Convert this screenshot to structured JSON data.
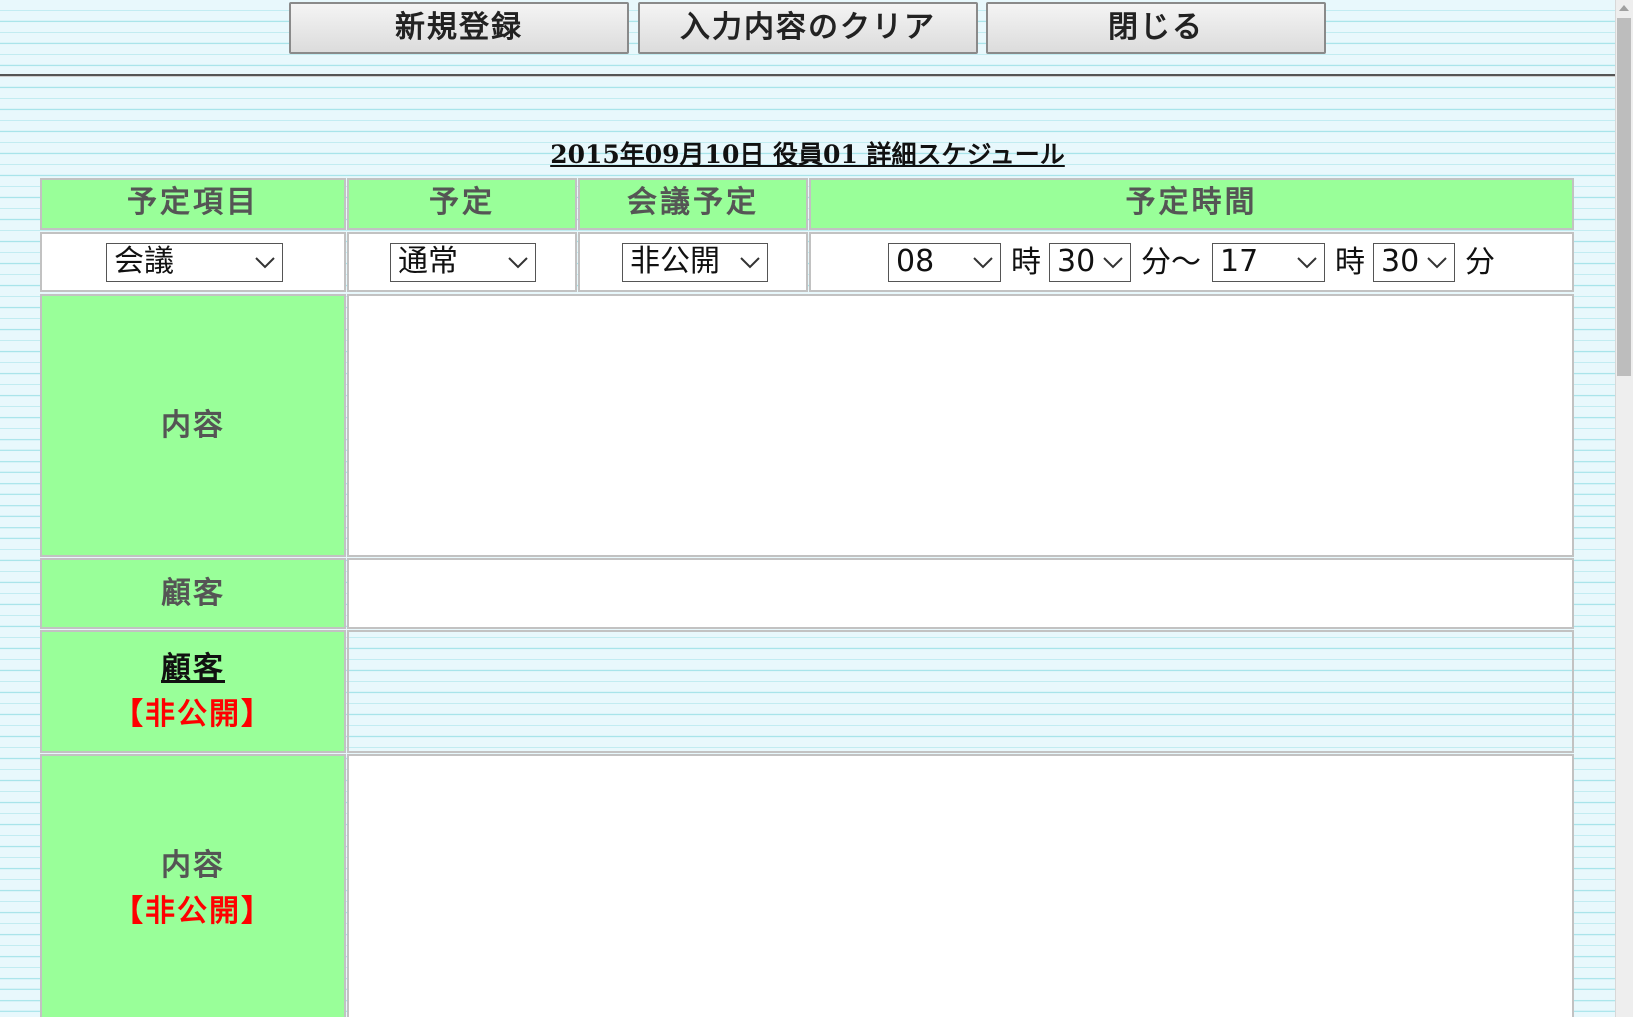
{
  "toolbar": {
    "register_label": "新規登録",
    "clear_label": "入力内容のクリア",
    "close_label": "閉じる"
  },
  "title": "2015年09月10日 役員01 詳細スケジュール",
  "headers": {
    "item": "予定項目",
    "schedule": "予定",
    "meeting": "会議予定",
    "time": "予定時間"
  },
  "selects": {
    "item": "会議",
    "schedule": "通常",
    "meeting": "非公開",
    "start_hour": "08",
    "start_minute": "30",
    "end_hour": "17",
    "end_minute": "30"
  },
  "time_units": {
    "hour": "時",
    "minute_range": "分〜",
    "minute": "分"
  },
  "labels": {
    "content": "内容",
    "customer": "顧客",
    "customer_private": "顧客",
    "private_tag": "【非公開】",
    "content_private": "内容",
    "private_tag_2": "【非公開】"
  },
  "colors": {
    "label_green": "#99ff99",
    "private_red": "#ff0000",
    "stripe_blue": "#a8e4ea"
  }
}
